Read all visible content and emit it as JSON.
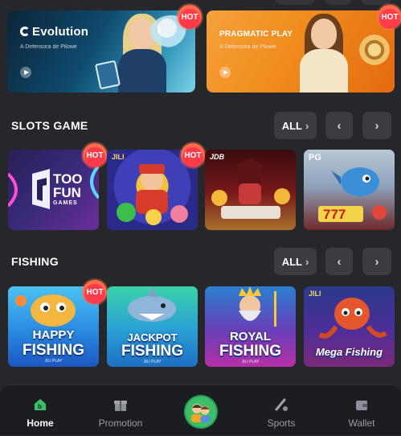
{
  "colors": {
    "background": "#26272b",
    "nav_bg": "#1c1d20",
    "accent_green": "#3dbf6a",
    "hot_red": "#ff3b49"
  },
  "banners": [
    {
      "brand": "Evolution",
      "subtitle": "A Defensora de Pilowe"
    },
    {
      "brand": "PRAGMATIC PLAY",
      "subtitle": "A Defensora de Pilowe"
    }
  ],
  "badge": {
    "hot": "HOT"
  },
  "sections": {
    "slots": {
      "title": "SLOTS GAME",
      "all_label": "ALL",
      "tiles": [
        {
          "name": "TOO FUN GAMES",
          "line1": "TOO",
          "line2": "FUN",
          "line3": "GAMES",
          "hot": true
        },
        {
          "name": "JILI",
          "provider": "JILI",
          "hot": true
        },
        {
          "name": "JDB",
          "provider": "JDB",
          "hot": false
        },
        {
          "name": "PG",
          "provider": "PG",
          "hot": false
        }
      ]
    },
    "fishing": {
      "title": "FISHING",
      "all_label": "ALL",
      "tiles": [
        {
          "line1": "HAPPY",
          "line2": "FISHING",
          "provider": "JILI PLAY",
          "hot": true
        },
        {
          "line1": "JACKPOT",
          "line2": "FISHING",
          "provider": "JILI PLAY",
          "hot": false
        },
        {
          "line1": "ROYAL",
          "line2": "FISHING",
          "provider": "JILI PLAY",
          "hot": false
        },
        {
          "line1": "Mega Fishing",
          "provider": "JILI",
          "hot": false
        }
      ]
    }
  },
  "nav": {
    "items": [
      {
        "label": "Home",
        "icon": "home-icon",
        "active": true
      },
      {
        "label": "Promotion",
        "icon": "gift-icon",
        "active": false
      },
      {
        "label": "",
        "icon": "avatar-icon",
        "active": false
      },
      {
        "label": "Sports",
        "icon": "sports-icon",
        "active": false
      },
      {
        "label": "Wallet",
        "icon": "wallet-icon",
        "active": false
      }
    ]
  }
}
